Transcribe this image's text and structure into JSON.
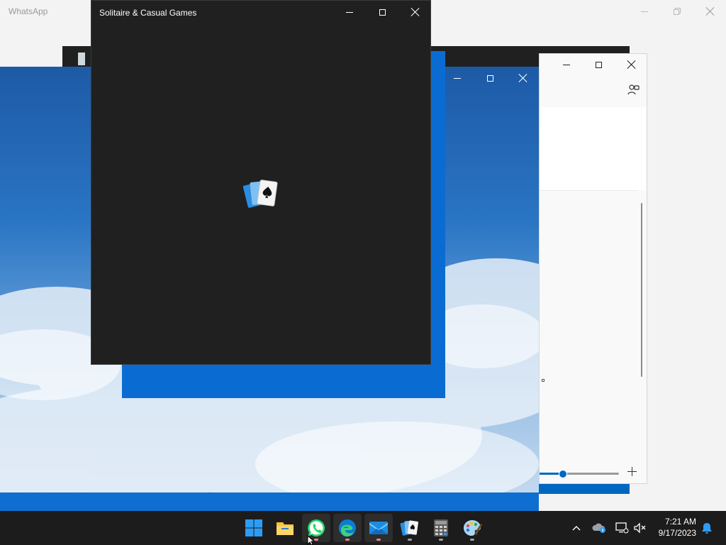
{
  "background_window": {
    "title": "WhatsApp"
  },
  "solitaire_window": {
    "title": "Solitaire & Casual Games"
  },
  "taskbar": {
    "apps": [
      {
        "name": "start-button",
        "icon": "windows-logo-icon",
        "indicator": false
      },
      {
        "name": "taskbar-file-explorer",
        "icon": "folder-icon",
        "indicator": false
      },
      {
        "name": "taskbar-whatsapp",
        "icon": "whatsapp-icon",
        "indicator": true,
        "indicator_color": "#e6838a"
      },
      {
        "name": "taskbar-edge",
        "icon": "edge-icon",
        "indicator": true,
        "indicator_color": "#e6838a"
      },
      {
        "name": "taskbar-mail",
        "icon": "mail-icon",
        "indicator": true,
        "indicator_color": "#e6838a"
      },
      {
        "name": "taskbar-solitaire",
        "icon": "cards-icon",
        "indicator": true
      },
      {
        "name": "taskbar-calculator",
        "icon": "calculator-icon",
        "indicator": true
      },
      {
        "name": "taskbar-paint",
        "icon": "paint-palette-icon",
        "indicator": true
      }
    ],
    "tray": {
      "time": "7:21 AM",
      "date": "9/17/2023"
    }
  },
  "colors": {
    "taskbar": "#1c1c1c",
    "solitaire_bg": "#202020",
    "accent_blue": "#0067c0",
    "desktop_blue": "#1761b0"
  }
}
